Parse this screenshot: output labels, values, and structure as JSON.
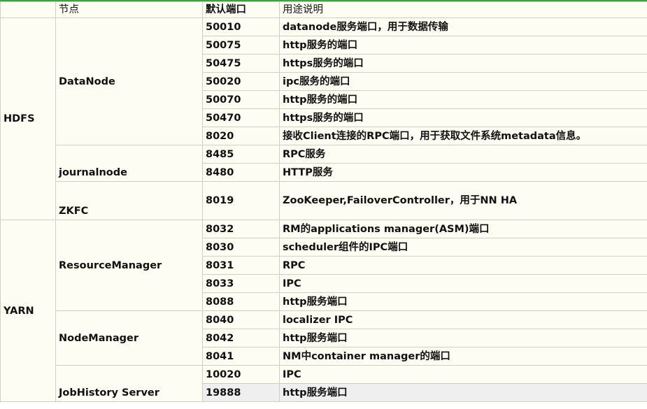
{
  "header": {
    "service": "",
    "node": "节点",
    "port": "默认端口",
    "desc": "用途说明"
  },
  "services": [
    {
      "name": "HDFS",
      "nodes": [
        {
          "name": "DataNode",
          "ports": [
            {
              "port": "50010",
              "desc": "datanode服务端口，用于数据传输"
            },
            {
              "port": "50075",
              "desc": "http服务的端口"
            },
            {
              "port": "50475",
              "desc": "https服务的端口"
            },
            {
              "port": "50020",
              "desc": "ipc服务的端口"
            },
            {
              "port": "50070",
              "desc": "http服务的端口"
            },
            {
              "port": "50470",
              "desc": "https服务的端口"
            },
            {
              "port": "8020",
              "desc": "接收Client连接的RPC端口，用于获取文件系统metadata信息。"
            }
          ]
        },
        {
          "name": "journalnode",
          "ports": [
            {
              "port": "8485",
              "desc": "RPC服务"
            },
            {
              "port": "8480",
              "desc": "HTTP服务"
            }
          ]
        },
        {
          "name": "ZKFC",
          "ports": [
            {
              "port": "8019",
              "desc": "ZooKeeper,FailoverController，用于NN HA"
            }
          ]
        }
      ]
    },
    {
      "name": "YARN",
      "nodes": [
        {
          "name": "ResourceManager",
          "ports": [
            {
              "port": "8032",
              "desc": "RM的applications manager(ASM)端口"
            },
            {
              "port": "8030",
              "desc": "scheduler组件的IPC端口"
            },
            {
              "port": "8031",
              "desc": "RPC"
            },
            {
              "port": "8033",
              "desc": "IPC"
            },
            {
              "port": "8088",
              "desc": "http服务端口"
            }
          ]
        },
        {
          "name": "NodeManager",
          "ports": [
            {
              "port": "8040",
              "desc": "localizer IPC"
            },
            {
              "port": "8042",
              "desc": "http服务端口"
            },
            {
              "port": "8041",
              "desc": "NM中container manager的端口"
            }
          ]
        },
        {
          "name": "JobHistory Server",
          "ports": [
            {
              "port": "10020",
              "desc": "IPC"
            },
            {
              "port": "19888",
              "desc": "http服务端口"
            }
          ]
        }
      ]
    }
  ]
}
